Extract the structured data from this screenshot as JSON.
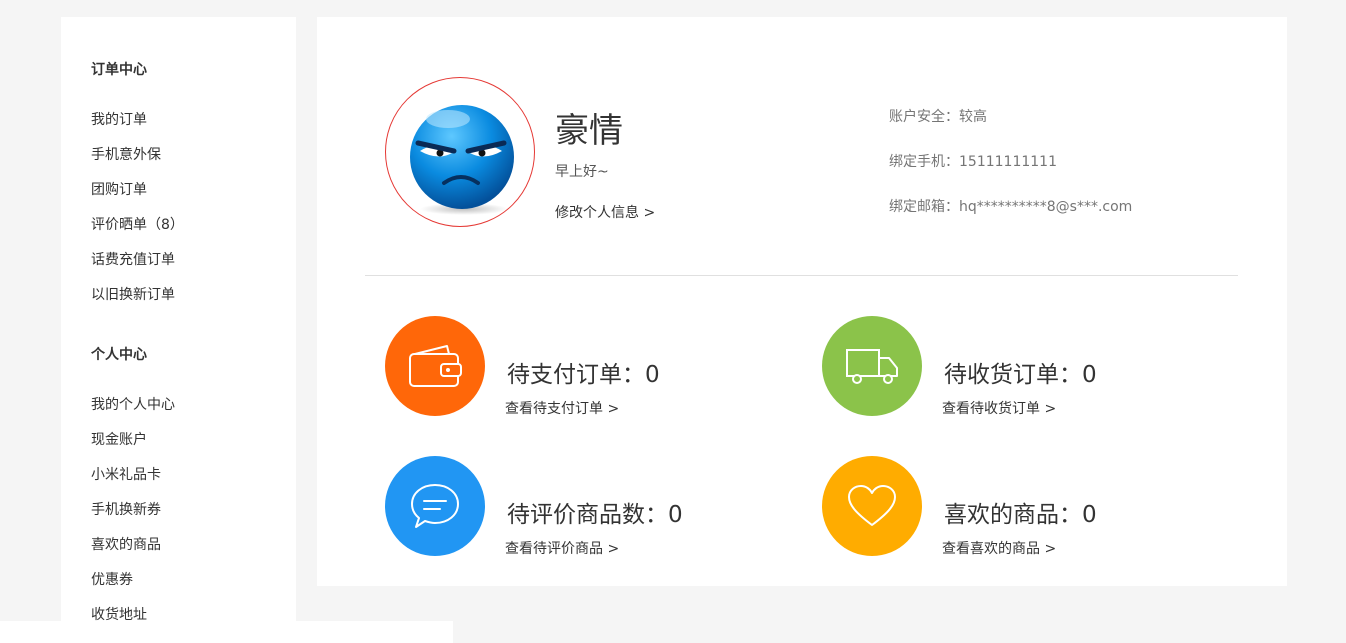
{
  "sidebar": {
    "groups": [
      {
        "title": "订单中心",
        "items": [
          "我的订单",
          "手机意外保",
          "团购订单",
          "评价晒单（8）",
          "话费充值订单",
          "以旧换新订单"
        ]
      },
      {
        "title": "个人中心",
        "items": [
          "我的个人中心",
          "现金账户",
          "小米礼品卡",
          "手机换新券",
          "喜欢的商品",
          "优惠券",
          "收货地址"
        ]
      }
    ]
  },
  "profile": {
    "name": "豪情",
    "greeting": "早上好~",
    "edit_link": "修改个人信息 >",
    "avatar_icon": "angry-face-avatar-icon"
  },
  "account": {
    "security": "账户安全：较高",
    "phone": "绑定手机：15111111111",
    "email": "绑定邮箱：hq**********8@s***.com"
  },
  "stats": [
    {
      "label": "待支付订单：",
      "count": "0",
      "link": "查看待支付订单 >",
      "icon": "wallet-icon",
      "color": "#ff6709"
    },
    {
      "label": "待收货订单：",
      "count": "0",
      "link": "查看待收货订单 >",
      "icon": "truck-icon",
      "color": "#8bc34a"
    },
    {
      "label": "待评价商品数：",
      "count": "0",
      "link": "查看待评价商品 >",
      "icon": "chat-bubble-icon",
      "color": "#2196f3"
    },
    {
      "label": "喜欢的商品：",
      "count": "0",
      "link": "查看喜欢的商品 >",
      "icon": "heart-icon",
      "color": "#ffac00"
    }
  ]
}
